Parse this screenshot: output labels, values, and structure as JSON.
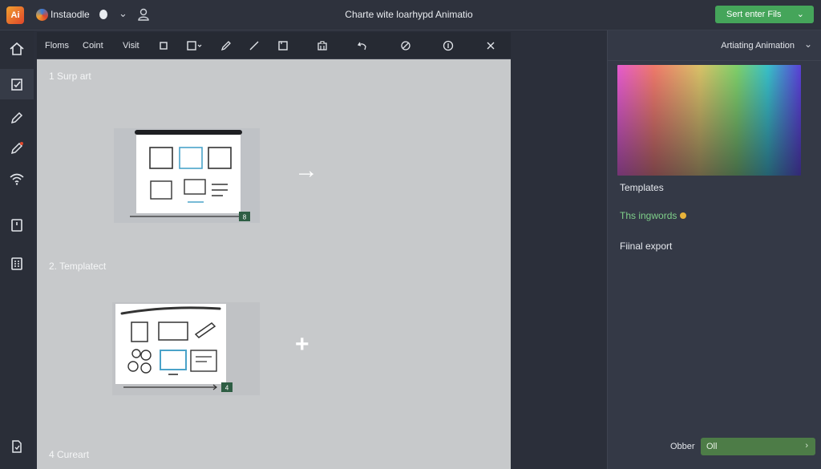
{
  "topbar": {
    "logo_text": "Ai",
    "brand_name": "Instaodle",
    "window_title": "Charte wite loarhypd Animatio",
    "primary_button": "Sert enter Fils"
  },
  "toolbar": {
    "items": [
      "Floms",
      "Coint",
      "Visit"
    ]
  },
  "canvas": {
    "steps": [
      "1  Surp art",
      "2. Templatect",
      "4  Cureart"
    ],
    "badges": [
      "8",
      "4"
    ]
  },
  "right_panel": {
    "header": "Artiating Animation",
    "rows": [
      "Templates",
      "Ths ingwords",
      "Fiinal export"
    ],
    "footer_label": "Obber",
    "footer_select": "Oll"
  },
  "colors": {
    "accent": "#45a55a",
    "panel": "#343946",
    "canvas": "#c7c9cb"
  }
}
